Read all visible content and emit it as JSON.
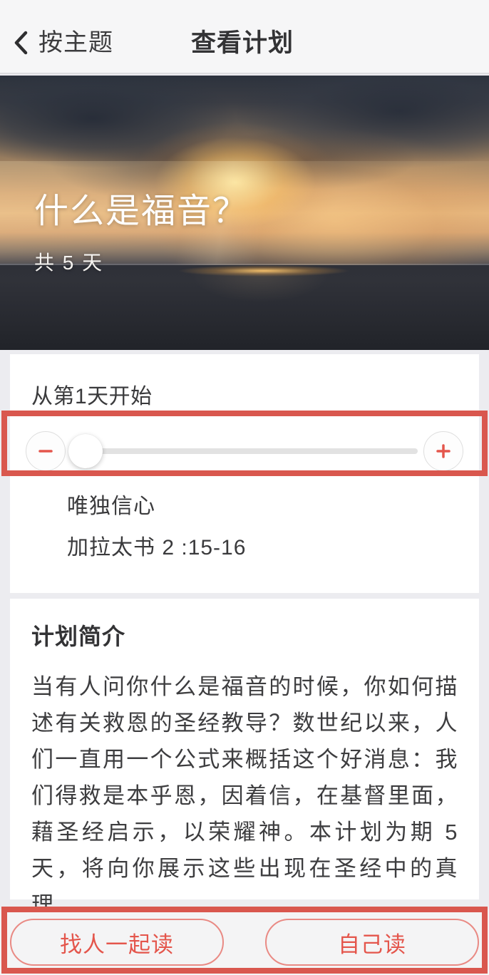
{
  "header": {
    "back_icon": "chevron-left-icon",
    "back_label": "按主题",
    "title": "查看计划"
  },
  "hero": {
    "title": "什么是福音？",
    "subtitle": "共 5 天",
    "image_description": "sunset-over-ocean-photo"
  },
  "start_card": {
    "label": "从第1天开始",
    "minus_icon": "minus-icon",
    "plus_icon": "plus-icon",
    "slider_value": 1,
    "slider_min": 1,
    "slider_max": 5,
    "day_title": "唯独信心",
    "day_reference": "加拉太书 2 :15-16"
  },
  "about_card": {
    "title": "计划简介",
    "body": "当有人问你什么是福音的时候，你如何描述有关救恩的圣经教导？数世纪以来，人们一直用一个公式来概括这个好消息：我们得救是本乎恩，因着信，在基督里面，藉圣经启示，以荣耀神。本计划为期 5 天，将向你展示这些出现在圣经中的真理。"
  },
  "bottom_bar": {
    "read_together_label": "找人一起读",
    "read_alone_label": "自己读"
  },
  "colors": {
    "accent_red": "#e4564c",
    "annotation_red": "#d9574e",
    "page_background": "#ececf0",
    "card_background": "#ffffff",
    "header_background": "#f6f6f7",
    "text_primary": "#3a3a3c"
  }
}
